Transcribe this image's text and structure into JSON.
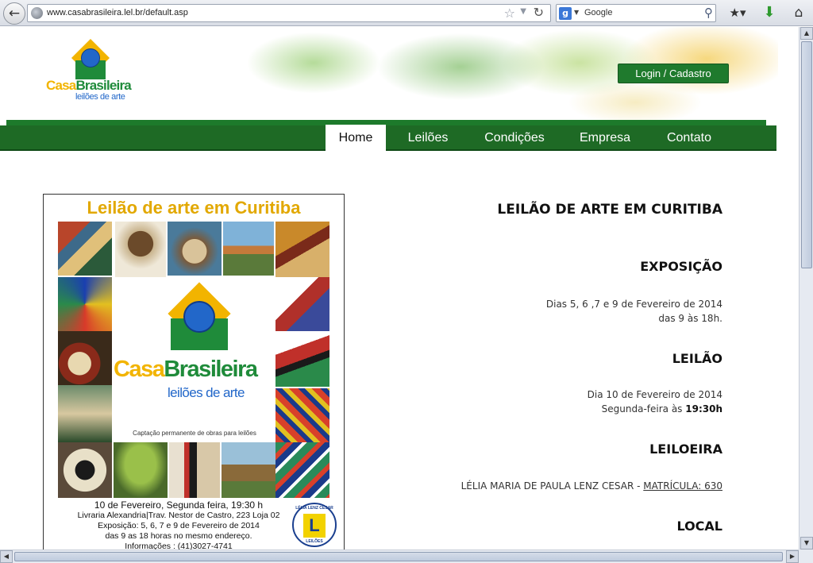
{
  "browser": {
    "url": "www.casabrasileira.lel.br/default.asp",
    "search_engine": "Google",
    "icons": {
      "back": "back-arrow-icon",
      "site": "globe-icon",
      "bookmark": "star-icon",
      "reload": "reload-icon",
      "search": "magnifier-icon",
      "bookmarks_menu": "bookmarks-icon",
      "downloads": "download-arrow-icon",
      "home": "home-icon"
    }
  },
  "site": {
    "logo": {
      "brand_casa": "Casa",
      "brand_brasileira": "Brasileira",
      "subtitle": "leilões de arte"
    },
    "login_label": "Login / Cadastro",
    "nav": [
      {
        "label": "Home",
        "active": true
      },
      {
        "label": "Leilões"
      },
      {
        "label": "Condições"
      },
      {
        "label": "Empresa"
      },
      {
        "label": "Contato"
      }
    ],
    "colors": {
      "nav_green": "#1e6a25",
      "logo_yellow": "#f2b400",
      "logo_green": "#1f8b3a",
      "logo_blue": "#2267c9"
    }
  },
  "poster": {
    "title": "Leilão de arte em Curitiba",
    "brand_casa": "Casa",
    "brand_brasileira": "Brasileira",
    "subtitle": "leilões de arte",
    "tagline": "Captação permanente de obras para leilões",
    "info": [
      "10 de Fevereiro, Segunda feira, 19:30 h",
      "Livraria Alexandria|Trav. Nestor de Castro, 223 Loja 02",
      "Exposição: 5, 6, 7 e 9 de Fevereiro de 2014",
      "das 9 as 18 horas no mesmo endereço.",
      "Informações : (41)3027-4741"
    ],
    "stamp_text": "LÉLIA LENZ CESAR",
    "stamp_letter": "L",
    "stamp_bottom": "LEILÕES"
  },
  "content": {
    "title": "LEILÃO DE ARTE EM CURITIBA",
    "exposicao": {
      "heading": "EXPOSIÇÃO",
      "line1": "Dias 5, 6 ,7 e 9 de Fevereiro de 2014",
      "line2": "das 9 às 18h."
    },
    "leilao": {
      "heading": "LEILÃO",
      "line1": "Dia 10 de Fevereiro de 2014",
      "line2_prefix": "Segunda-feira às ",
      "line2_time": "19:30h"
    },
    "leiloeira": {
      "heading": "LEILOEIRA",
      "name": "LÉLIA MARIA DE PAULA LENZ CESAR - ",
      "matricula": "MATRÍCULA: 630"
    },
    "local": {
      "heading": "LOCAL"
    }
  }
}
